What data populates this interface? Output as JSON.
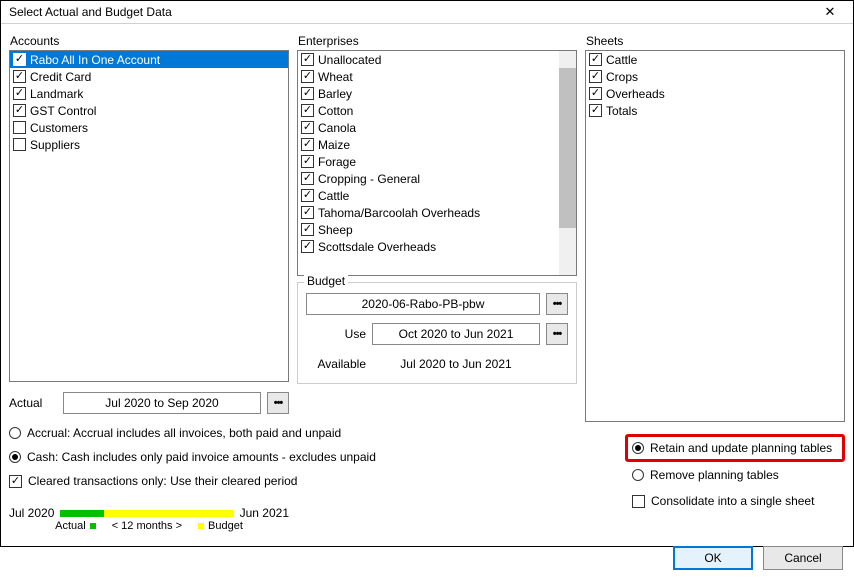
{
  "title": "Select Actual and Budget Data",
  "accounts": {
    "label": "Accounts",
    "items": [
      {
        "label": "Rabo All In One Account",
        "checked": true,
        "selected": true
      },
      {
        "label": "Credit Card",
        "checked": true
      },
      {
        "label": "Landmark",
        "checked": true
      },
      {
        "label": "GST Control",
        "checked": true
      },
      {
        "label": "Customers",
        "checked": false
      },
      {
        "label": "Suppliers",
        "checked": false
      }
    ]
  },
  "enterprises": {
    "label": "Enterprises",
    "items": [
      {
        "label": "Unallocated",
        "checked": true
      },
      {
        "label": "Wheat",
        "checked": true
      },
      {
        "label": "Barley",
        "checked": true
      },
      {
        "label": "Cotton",
        "checked": true
      },
      {
        "label": "Canola",
        "checked": true
      },
      {
        "label": "Maize",
        "checked": true
      },
      {
        "label": "Forage",
        "checked": true
      },
      {
        "label": "Cropping - General",
        "checked": true
      },
      {
        "label": "Cattle",
        "checked": true
      },
      {
        "label": "Tahoma/Barcoolah Overheads",
        "checked": true
      },
      {
        "label": "Sheep",
        "checked": true
      },
      {
        "label": "Scottsdale Overheads",
        "checked": true
      }
    ]
  },
  "sheets": {
    "label": "Sheets",
    "items": [
      {
        "label": "Cattle",
        "checked": true
      },
      {
        "label": "Crops",
        "checked": true
      },
      {
        "label": "Overheads",
        "checked": true
      },
      {
        "label": "Totals",
        "checked": true
      }
    ]
  },
  "actual": {
    "label": "Actual",
    "range": "Jul 2020 to Sep 2020"
  },
  "budget": {
    "label": "Budget",
    "file": "2020-06-Rabo-PB-pbw",
    "use_label": "Use",
    "use_range": "Oct 2020 to Jun 2021",
    "available_label": "Available",
    "available_range": "Jul 2020 to Jun 2021"
  },
  "basis": {
    "accrual": "Accrual: Accrual includes all invoices, both paid and unpaid",
    "cash": "Cash: Cash includes only paid invoice amounts - excludes unpaid",
    "cleared": "Cleared transactions only: Use their cleared period"
  },
  "timeline": {
    "start": "Jul 2020",
    "end": "Jun 2021",
    "actual_label": "Actual",
    "middle": "< 12 months >",
    "budget_label": "Budget"
  },
  "options": {
    "retain": "Retain and update planning tables",
    "remove": "Remove planning tables",
    "consolidate": "Consolidate into a single sheet"
  },
  "buttons": {
    "ok": "OK",
    "cancel": "Cancel"
  }
}
